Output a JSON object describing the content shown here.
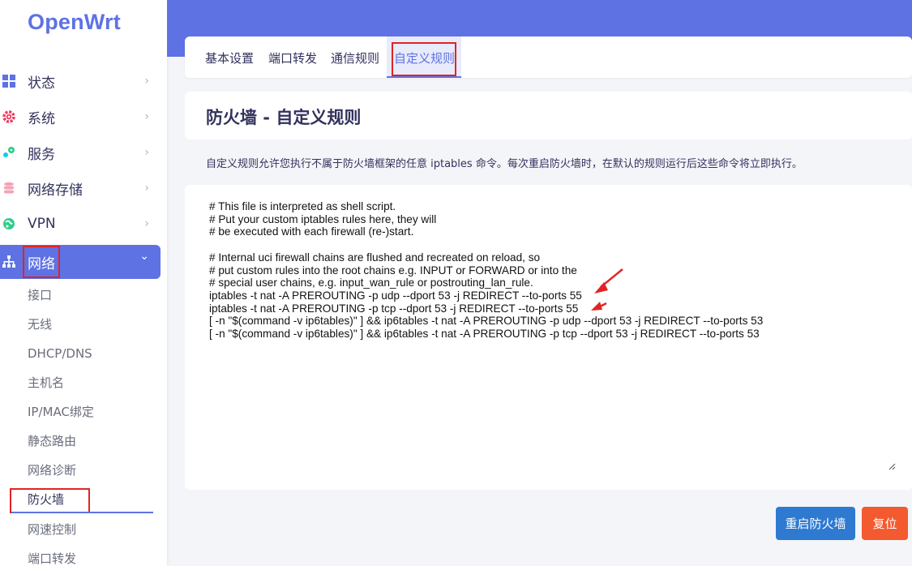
{
  "app": {
    "logo": "OpenWrt"
  },
  "sidebar": {
    "menu": [
      {
        "label": "状态",
        "icon": "dashboard-icon"
      },
      {
        "label": "系统",
        "icon": "gear-icon"
      },
      {
        "label": "服务",
        "icon": "services-icon"
      },
      {
        "label": "网络存储",
        "icon": "storage-icon"
      },
      {
        "label": "VPN",
        "icon": "vpn-icon"
      },
      {
        "label": "网络",
        "icon": "network-icon",
        "expanded": true
      }
    ],
    "submenu": [
      "接口",
      "无线",
      "DHCP/DNS",
      "主机名",
      "IP/MAC绑定",
      "静态路由",
      "网络诊断",
      "防火墙",
      "网速控制",
      "端口转发"
    ],
    "current_submenu": "防火墙",
    "chevron_right": "›",
    "chevron_down": "⌄"
  },
  "tabs": [
    {
      "label": "基本设置"
    },
    {
      "label": "端口转发"
    },
    {
      "label": "通信规则"
    },
    {
      "label": "自定义规则",
      "active": true
    }
  ],
  "page": {
    "title": "防火墙 - 自定义规则",
    "description": "自定义规则允许您执行不属于防火墙框架的任意 iptables 命令。每次重启防火墙时，在默认的规则运行后这些命令将立即执行。"
  },
  "editor": {
    "content": "# This file is interpreted as shell script.\n# Put your custom iptables rules here, they will\n# be executed with each firewall (re-)start.\n\n# Internal uci firewall chains are flushed and recreated on reload, so\n# put custom rules into the root chains e.g. INPUT or FORWARD or into the\n# special user chains, e.g. input_wan_rule or postrouting_lan_rule.\niptables -t nat -A PREROUTING -p udp --dport 53 -j REDIRECT --to-ports 55\niptables -t nat -A PREROUTING -p tcp --dport 53 -j REDIRECT --to-ports 55\n[ -n \"$(command -v ip6tables)\" ] && ip6tables -t nat -A PREROUTING -p udp --dport 53 -j REDIRECT --to-ports 53\n[ -n \"$(command -v ip6tables)\" ] && ip6tables -t nat -A PREROUTING -p tcp --dport 53 -j REDIRECT --to-ports 53"
  },
  "actions": {
    "restart_label": "重启防火墙",
    "reset_label": "复位"
  },
  "colors": {
    "accent": "#5e72e4",
    "annotation_red": "#e02424",
    "restart_button": "#2e7ad1",
    "reset_button": "#f35a2f"
  }
}
